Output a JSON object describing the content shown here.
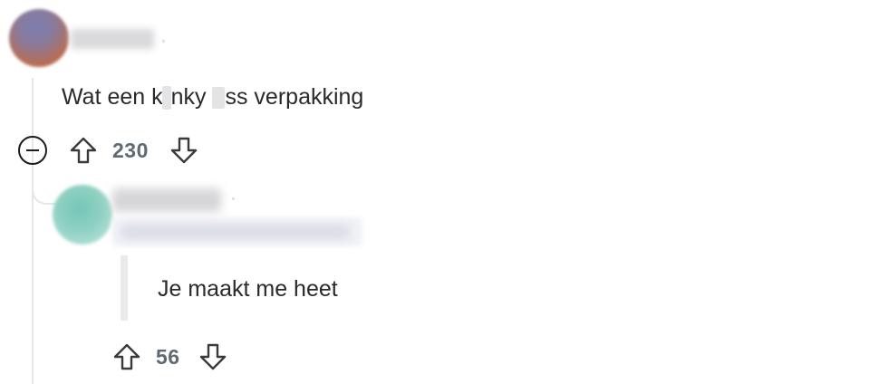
{
  "comment": {
    "text_part1": "Wat een k",
    "text_part2": "nky ",
    "text_part3": "ss verpakking",
    "score": "230",
    "icons": {
      "collapse": "collapse-minus-icon",
      "upvote": "upvote-arrow-icon",
      "downvote": "downvote-arrow-icon"
    }
  },
  "reply": {
    "text": "Je maakt me heet",
    "score": "56"
  },
  "colors": {
    "text": "#2a2a2a",
    "score": "#5f6a73",
    "thread_line": "#e6e6e8"
  }
}
